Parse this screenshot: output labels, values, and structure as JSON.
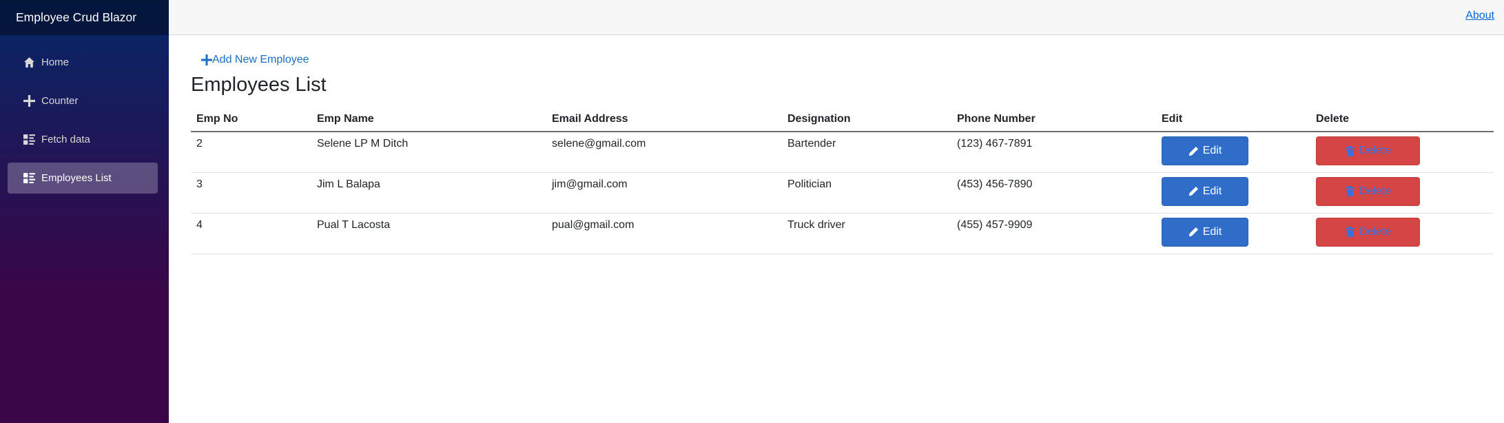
{
  "app": {
    "brand": "Employee Crud Blazor"
  },
  "sidebar": {
    "items": [
      {
        "label": "Home",
        "icon": "home-icon",
        "active": false
      },
      {
        "label": "Counter",
        "icon": "plus-icon",
        "active": false
      },
      {
        "label": "Fetch data",
        "icon": "list-rich-icon",
        "active": false
      },
      {
        "label": "Employees List",
        "icon": "list-rich-icon",
        "active": true
      }
    ]
  },
  "header": {
    "about_label": "About"
  },
  "main": {
    "add_link_label": "Add New Employee",
    "title": "Employees List",
    "table": {
      "columns": [
        "Emp No",
        "Emp Name",
        "Email Address",
        "Designation",
        "Phone Number",
        "Edit",
        "Delete"
      ],
      "rows": [
        {
          "emp_no": "2",
          "name": "Selene LP M Ditch",
          "email": "selene@gmail.com",
          "designation": "Bartender",
          "phone": "(123) 467-7891"
        },
        {
          "emp_no": "3",
          "name": "Jim L Balapa",
          "email": "jim@gmail.com",
          "designation": "Politician",
          "phone": "(453) 456-7890"
        },
        {
          "emp_no": "4",
          "name": "Pual T Lacosta",
          "email": "pual@gmail.com",
          "designation": "Truck driver",
          "phone": "(455) 457-9909"
        }
      ],
      "edit_label": "Edit",
      "delete_label": "Delete"
    }
  },
  "colors": {
    "sidebar_top": "#052767",
    "sidebar_bottom": "#3a0647",
    "link": "#1b6ec2",
    "edit_button": "#2f6dc9",
    "delete_button": "#d64545"
  }
}
